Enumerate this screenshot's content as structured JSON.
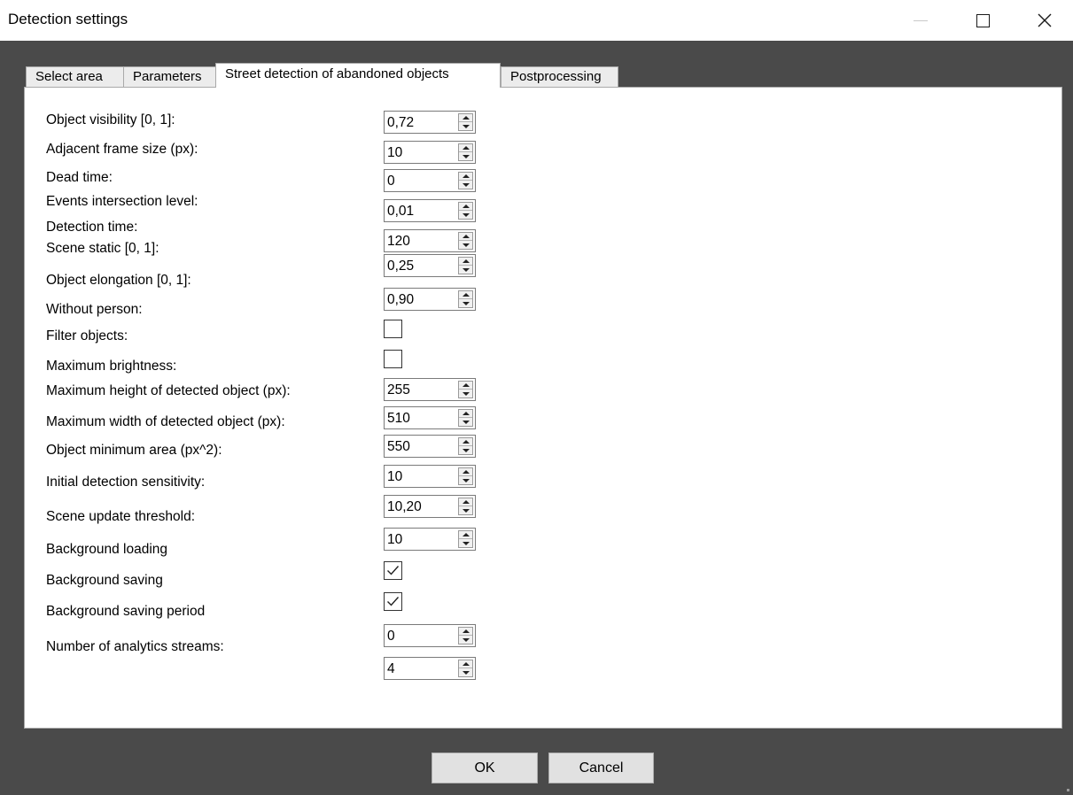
{
  "window": {
    "title": "Detection settings",
    "controls": [
      "minimize-icon",
      "maximize-icon",
      "close-icon"
    ]
  },
  "tabs": [
    {
      "label": "Select area",
      "active": false
    },
    {
      "label": "Parameters",
      "active": false
    },
    {
      "label": "Street detection of abandoned objects",
      "active": true
    },
    {
      "label": "Postprocessing",
      "active": false
    }
  ],
  "fields": [
    {
      "label": "Object visibility [0, 1]:",
      "type": "spin",
      "value": "0,72"
    },
    {
      "label": "Adjacent frame size (px):",
      "type": "spin",
      "value": "10"
    },
    {
      "label": "Dead time:",
      "type": "spin",
      "value": "0"
    },
    {
      "label": "Events intersection level:",
      "type": "spin",
      "value": "0,01"
    },
    {
      "label": "Detection time:",
      "type": "spin",
      "value": "120"
    },
    {
      "label": "Scene static [0, 1]:",
      "type": "spin",
      "value": "0,25"
    },
    {
      "label": "Object elongation [0, 1]:",
      "type": "spin",
      "value": "0,90"
    },
    {
      "label": "Without person:",
      "type": "checkbox",
      "checked": false
    },
    {
      "label": "Filter objects:",
      "type": "checkbox",
      "checked": false
    },
    {
      "label": "Maximum brightness:",
      "type": "spin",
      "value": "255"
    },
    {
      "label": "Maximum height of detected object (px):",
      "type": "spin",
      "value": "510"
    },
    {
      "label": "Maximum width of detected object (px):",
      "type": "spin",
      "value": "550"
    },
    {
      "label": "Object minimum area (px^2):",
      "type": "spin",
      "value": "10"
    },
    {
      "label": "Initial detection sensitivity:",
      "type": "spin",
      "value": "10,20"
    },
    {
      "label": "Scene update threshold:",
      "type": "spin",
      "value": "10"
    },
    {
      "label": "Background loading",
      "type": "checkbox",
      "checked": true
    },
    {
      "label": "Background saving",
      "type": "checkbox",
      "checked": true
    },
    {
      "label": "Background saving period",
      "type": "spin",
      "value": "0"
    },
    {
      "label": "Number of analytics streams:",
      "type": "spin",
      "value": "4"
    }
  ],
  "buttons": {
    "ok": "OK",
    "cancel": "Cancel"
  },
  "colors": {
    "dialog_background": "#4a4a4a",
    "panel": "#ffffff",
    "button": "#e1e1e1"
  }
}
